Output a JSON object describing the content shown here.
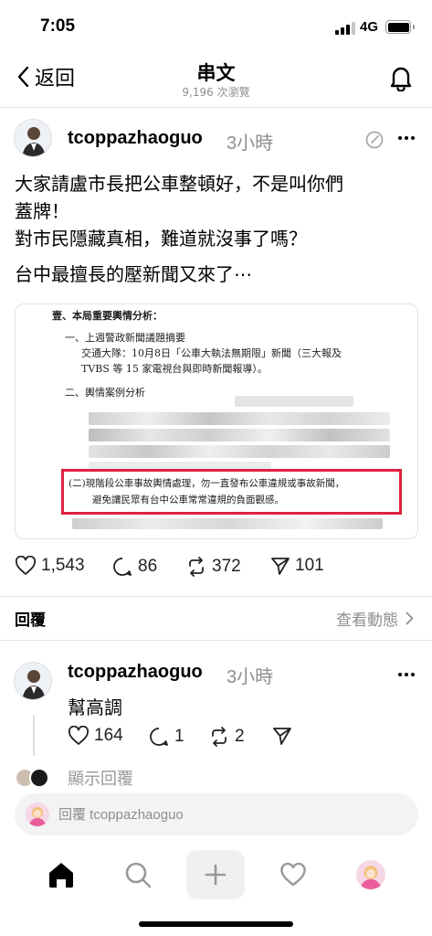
{
  "status_bar": {
    "time": "7:05",
    "network": "4G"
  },
  "nav": {
    "back_label": "返回",
    "title": "串文",
    "subtitle": "9,196 次瀏覽"
  },
  "post": {
    "username": "tcoppazhaoguo",
    "time_ago": "3小時",
    "text_lines": [
      "大家請盧市長把公車整頓好，不是叫你們",
      "蓋牌！",
      "對市民隱藏真相，難道就沒事了嗎？",
      "台中最擅長的壓新聞又來了⋯"
    ],
    "document": {
      "line1": "壹、本局重要輿情分析：",
      "line2": "一、上週警政新聞議題摘要",
      "line3": "交通大隊：10月8日「公車大執法無期限」新聞（三大報及",
      "line4": "TVBS 等 15 家電視台與即時新聞報導）。",
      "line5": "二、輿情案例分析",
      "highlight_line1": "(二)現階段公車事故輿情處理，勿一直發布公車違規或事故新聞，",
      "highlight_line2": "避免讓民眾有台中公車常常違規的負面觀感。",
      "highlight_color": "#e0213f"
    },
    "stats": {
      "likes": "1,543",
      "comments": "86",
      "reposts": "372",
      "shares": "101"
    }
  },
  "replies_header": {
    "label": "回覆",
    "activity_label": "查看動態"
  },
  "reply": {
    "username": "tcoppazhaoguo",
    "time_ago": "3小時",
    "text": "幫高調",
    "stats": {
      "likes": "164",
      "comments": "1",
      "reposts": "2"
    },
    "show_replies_label": "顯示回覆"
  },
  "composer": {
    "placeholder": "回覆 tcoppazhaoguo"
  },
  "tabs": [
    "home-icon",
    "search-icon",
    "plus-icon",
    "heart-icon",
    "profile-avatar"
  ]
}
